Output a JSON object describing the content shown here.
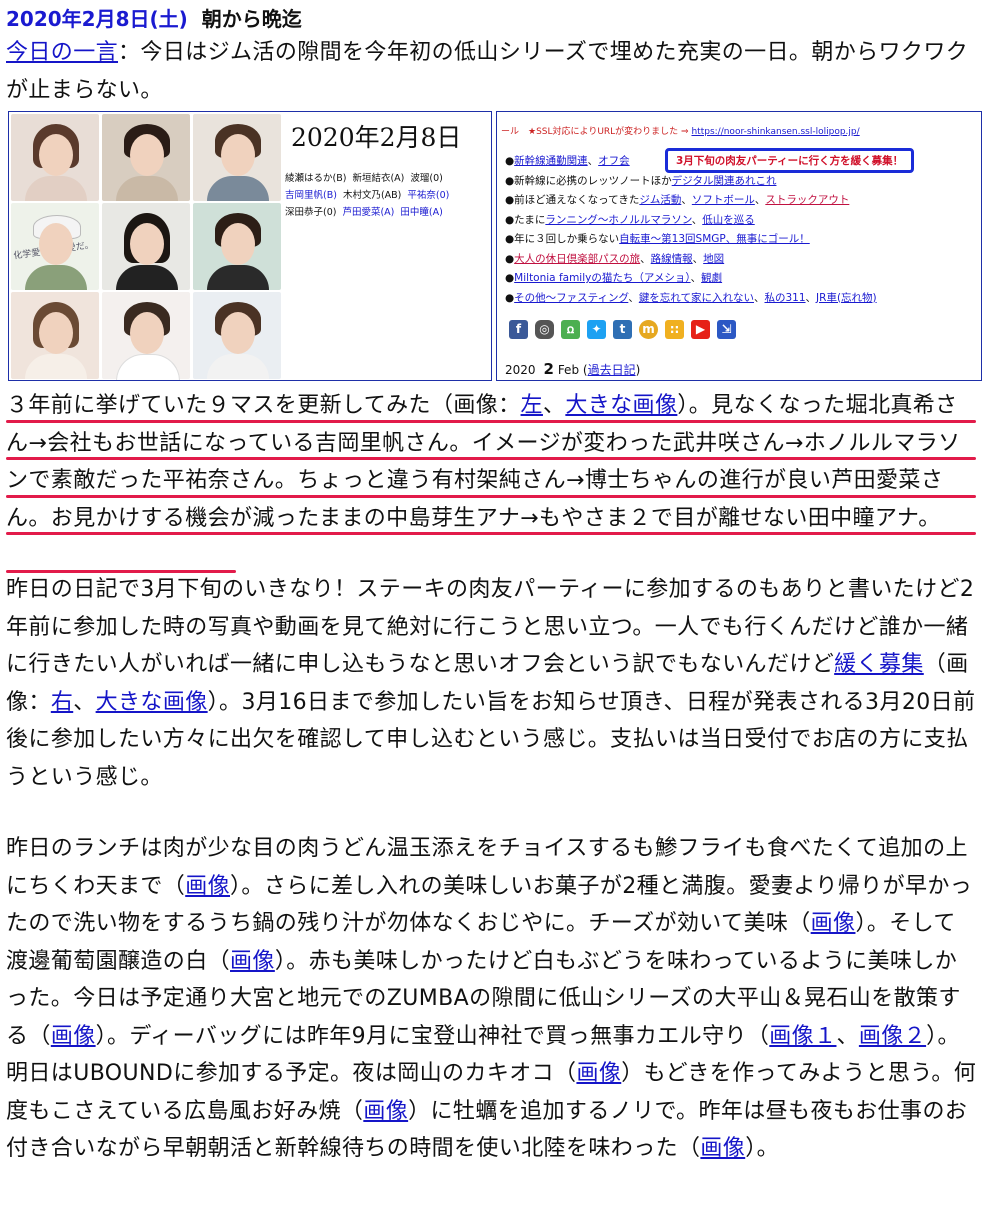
{
  "header": {
    "date": "2020年2月8日(土)",
    "title": "朝から晩迄"
  },
  "intro": {
    "link_label": "今日の一言",
    "text": "：今日はジム活の隙間を今年初の低山シリーズで埋めた充実の一日。朝からワクワクが止まらない。"
  },
  "left_panel": {
    "date": "2020年2月8日",
    "names": [
      [
        "綾瀬はるか(B)",
        "新垣結衣(A)",
        "波瑠(0)"
      ],
      [
        "吉岡里帆(B)",
        "木村文乃(AB)",
        "平祐奈(0)"
      ],
      [
        "深田恭子(0)",
        "芦田愛菜(A)",
        "田中瞳(A)"
      ]
    ],
    "note": "化学愛は人類愛だ。"
  },
  "right_panel": {
    "url_prefix": "ール　★SSL対応によりURLが変わりました ⇒",
    "url": "https://noor-shinkansen.ssl-lolipop.jp/",
    "callout": "3月下旬の肉友パーティーに行く方を緩く募集！",
    "menu": [
      {
        "pre": "●",
        "links": [
          "新幹線通勤関連",
          "オフ会"
        ],
        "rest": ""
      },
      {
        "pre": "●新幹線に必携のレッツノートほか",
        "links": [
          "デジタル関連あれこれ"
        ],
        "rest": ""
      },
      {
        "pre": "●前ほど通えなくなってきた",
        "links": [
          "ジム活動",
          "ソフトボール",
          "ストラックアウト"
        ],
        "rest": ""
      },
      {
        "pre": "●たまに",
        "links": [
          "ランニング〜ホノルルマラソン",
          "低山を巡る"
        ],
        "rest": ""
      },
      {
        "pre": "●年に３回しか乗らない",
        "links": [
          "自転車〜第13回SMGP、無事にゴール！"
        ],
        "rest": ""
      },
      {
        "pre": "●",
        "links": [
          "大人の休日倶楽部パスの旅",
          "路線情報",
          "地図"
        ],
        "rest": ""
      },
      {
        "pre": "●",
        "links": [
          "Miltonia familyの猫たち（アメショ）",
          "観劇"
        ],
        "rest": ""
      },
      {
        "pre": "●",
        "links": [
          "その他〜ファスティング",
          "鍵を忘れて家に入れない",
          "私の311",
          "JR車(忘れ物)"
        ],
        "rest": ""
      }
    ],
    "social_icons": [
      "facebook-icon",
      "instagram-icon",
      "line-icon",
      "twitter-icon",
      "tumblr-icon",
      "mixi-icon",
      "hatena-icon",
      "youtube-icon",
      "login-icon"
    ],
    "footer_year": "2020",
    "footer_num": "2",
    "footer_month": "Feb",
    "footer_link": "過去日記"
  },
  "para1": {
    "t1": "３年前に挙げていた９マスを更新してみた（画像：",
    "l1": "左",
    "t2": "、",
    "l2": "大きな画像",
    "t3": "）。見なくなった堀北真希さん→会社もお世話になっている吉岡里帆さん。イメージが変わった武井咲さん→ホノルルマラソンで素敵だった平祐奈さん。ちょっと違う有村架純さん→博士ちゃんの進行が良い芦田愛菜さん。お見かけする機会が減ったままの中島芽生アナ→もやさま２で目が離せない田中瞳アナ。"
  },
  "para2": {
    "t1": "昨日の日記で3月下旬のいきなり！ステーキの肉友パーティーに参加するのもありと書いたけど2年前に参加した時の写真や動画を見て絶対に行こうと思い立つ。一人でも行くんだけど誰か一緒に行きたい人がいれば一緒に申し込もうなと思いオフ会という訳でもないんだけど",
    "l1": "緩く募集",
    "t2": "（画像：",
    "l2": "右",
    "t3": "、",
    "l3": "大きな画像",
    "t4": "）。3月16日まで参加したい旨をお知らせ頂き、日程が発表される3月20日前後に参加したい方々に出欠を確認して申し込むという感じ。支払いは当日受付でお店の方に支払うという感じ。"
  },
  "para3": {
    "t1": "昨日のランチは肉が少な目の肉うどん温玉添えをチョイスするも鯵フライも食べたくて追加の上にちくわ天まで（",
    "l1": "画像",
    "t2": "）。さらに差し入れの美味しいお菓子が2種と満腹。愛妻より帰りが早かったので洗い物をするうち鍋の残り汁が勿体なくおじやに。チーズが効いて美味（",
    "l2": "画像",
    "t3": "）。そして渡邊葡萄園醸造の白（",
    "l3": "画像",
    "t4": "）。赤も美味しかったけど白もぶどうを味わっているように美味しかった。今日は予定通り大宮と地元でのZUMBAの隙間に低山シリーズの大平山＆晃石山を散策する（",
    "l4": "画像",
    "t5": "）。ディーバッグには昨年9月に宝登山神社で買っ無事カエル守り（",
    "l5": "画像１",
    "t6": "、",
    "l6": "画像２",
    "t7": "）。明日はUBOUNDに参加する予定。夜は岡山のカキオコ（",
    "l7": "画像",
    "t8": "）もどきを作ってみようと思う。何度もこさえている広島風お好み焼（",
    "l8": "画像",
    "t9": "）に牡蠣を追加するノリで。昨年は昼も夜もお仕事のお付き合いながら早朝朝活と新幹線待ちの時間を使い北陸を味わった（",
    "l9": "画像",
    "t10": "）。"
  },
  "colors": {
    "link": "#1515c8",
    "date": "#1a1ad0",
    "underline": "#e21b4a",
    "panel_border": "#1e2fa8"
  }
}
